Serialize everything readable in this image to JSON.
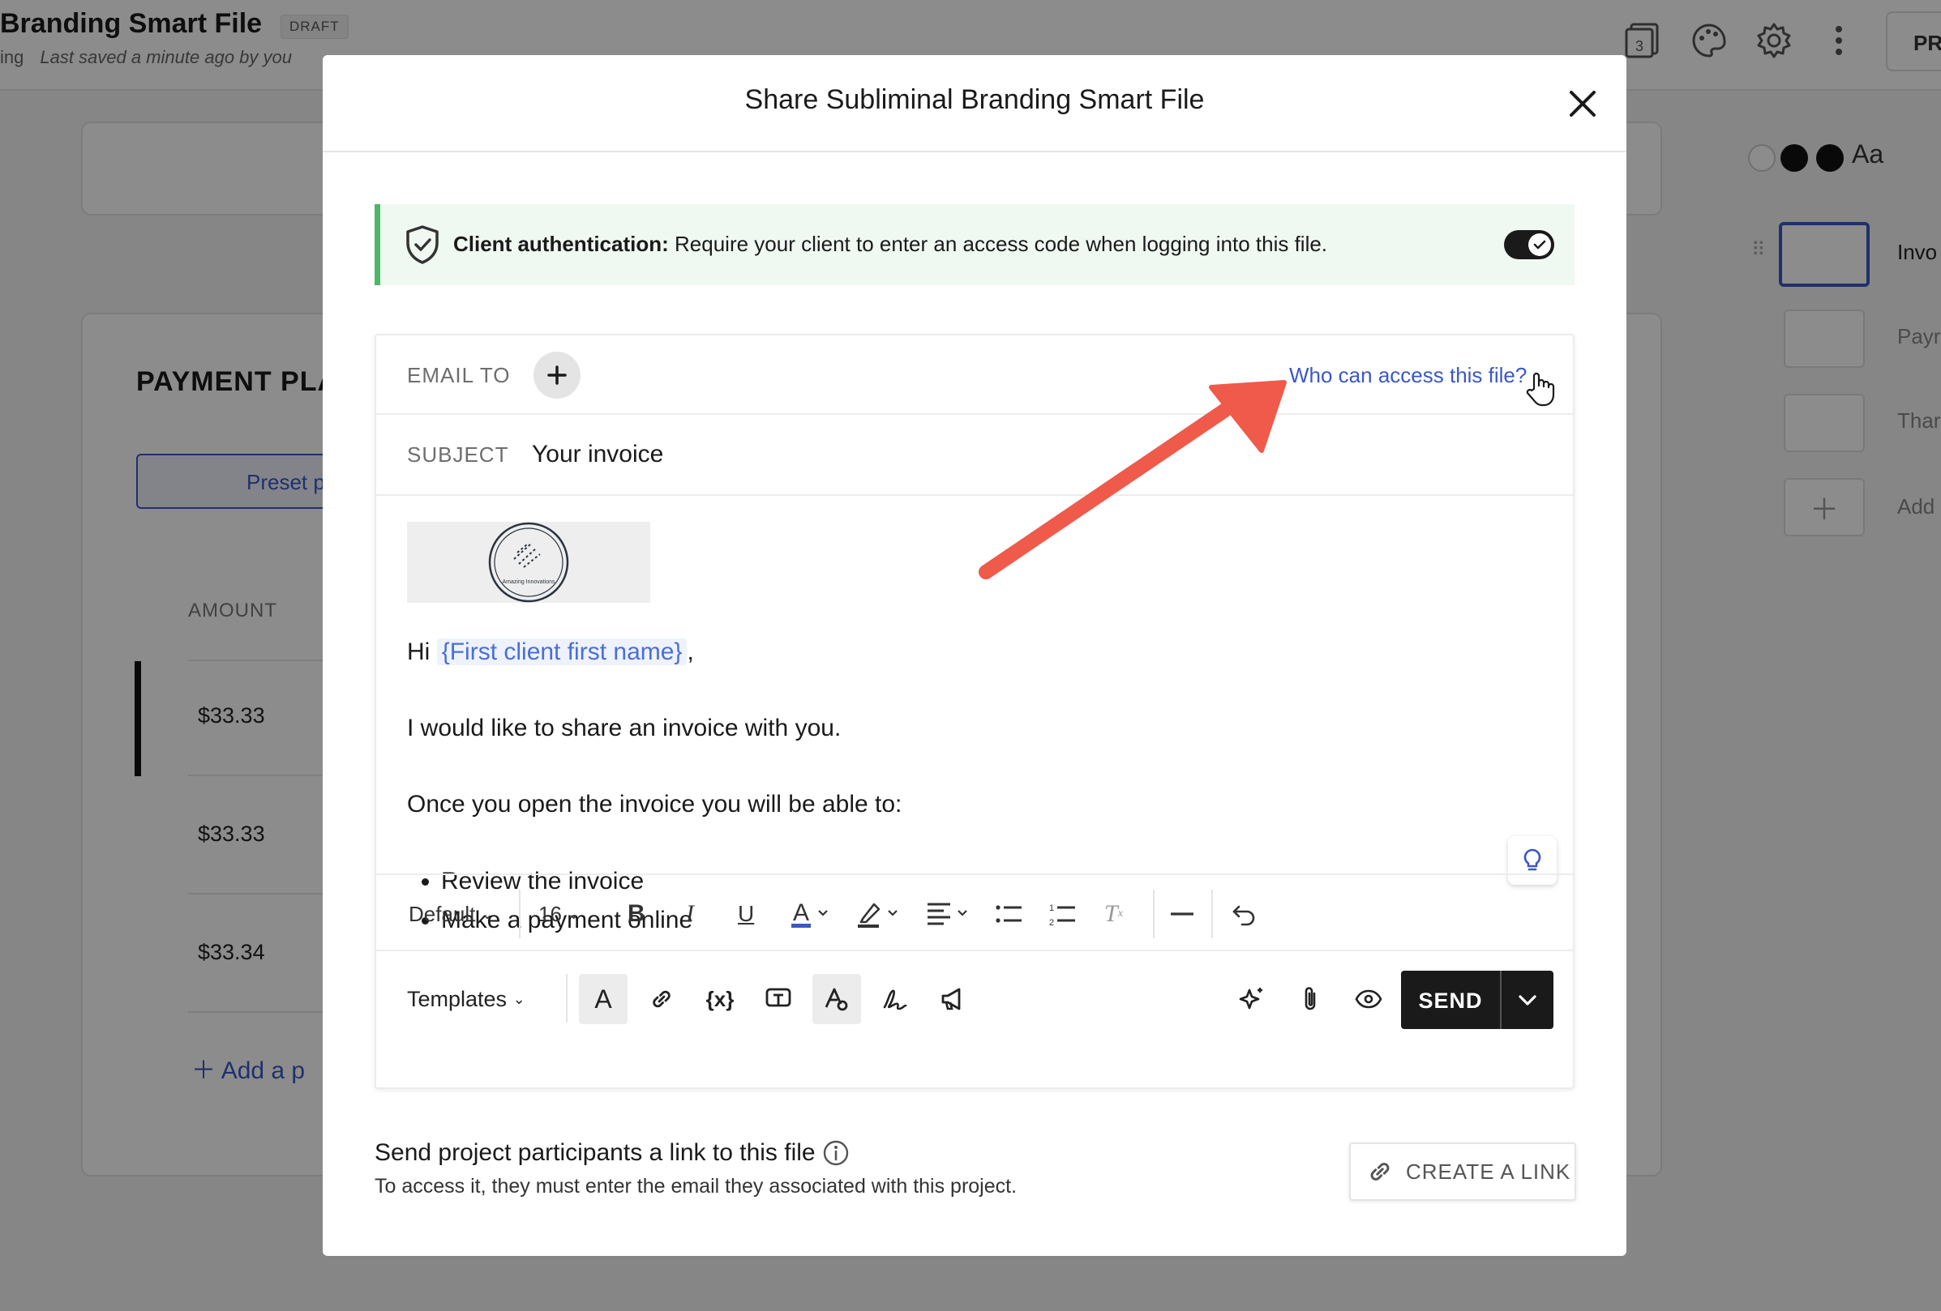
{
  "app": {
    "title": "Branding Smart File",
    "badge": "DRAFT",
    "subtitle_prefix": "ing",
    "last_saved": "Last saved a minute ago by you",
    "header_badge_count": "3",
    "header_button": "PR",
    "payment_title": "PAYMENT PLA",
    "preset_button": "Preset p",
    "amount_header": "AMOUNT",
    "amounts": [
      "$33.33",
      "$33.33",
      "$33.34"
    ],
    "add_payment": "Add a p",
    "sidebar": {
      "font_label": "Aa",
      "pages": [
        "Invo",
        "Payr",
        "Thar"
      ],
      "add_page": "Add p"
    }
  },
  "modal": {
    "title": "Share Subliminal Branding Smart File",
    "auth": {
      "label": "Client authentication:",
      "text": " Require your client to enter an access code when logging into this file.",
      "enabled": true
    },
    "email_to_label": "EMAIL TO",
    "who_can_access": "Who can access this file?",
    "subject_label": "SUBJECT",
    "subject_value": "Your invoice",
    "logo_caption": "Amazing Innovations",
    "body": {
      "greeting": "Hi",
      "token": "{First client first name}",
      "greeting_end": ",",
      "line1": "I would like to share an invoice with you.",
      "line2": "Once you open the invoice you will be able to:",
      "bullets": [
        "Review the invoice",
        "Make a payment online"
      ]
    },
    "toolbar": {
      "style": "Default",
      "size": "16"
    },
    "bottom": {
      "templates": "Templates",
      "send": "SEND"
    },
    "participants": {
      "title": "Send project participants a link to this file",
      "subtitle": "To access it, they must enter the email they associated with this project.",
      "create_link": "CREATE A LINK"
    },
    "colors": {
      "accent": "#3b58c4",
      "auth_green": "#4cb868",
      "annotation_arrow": "#ef5a4a"
    }
  }
}
